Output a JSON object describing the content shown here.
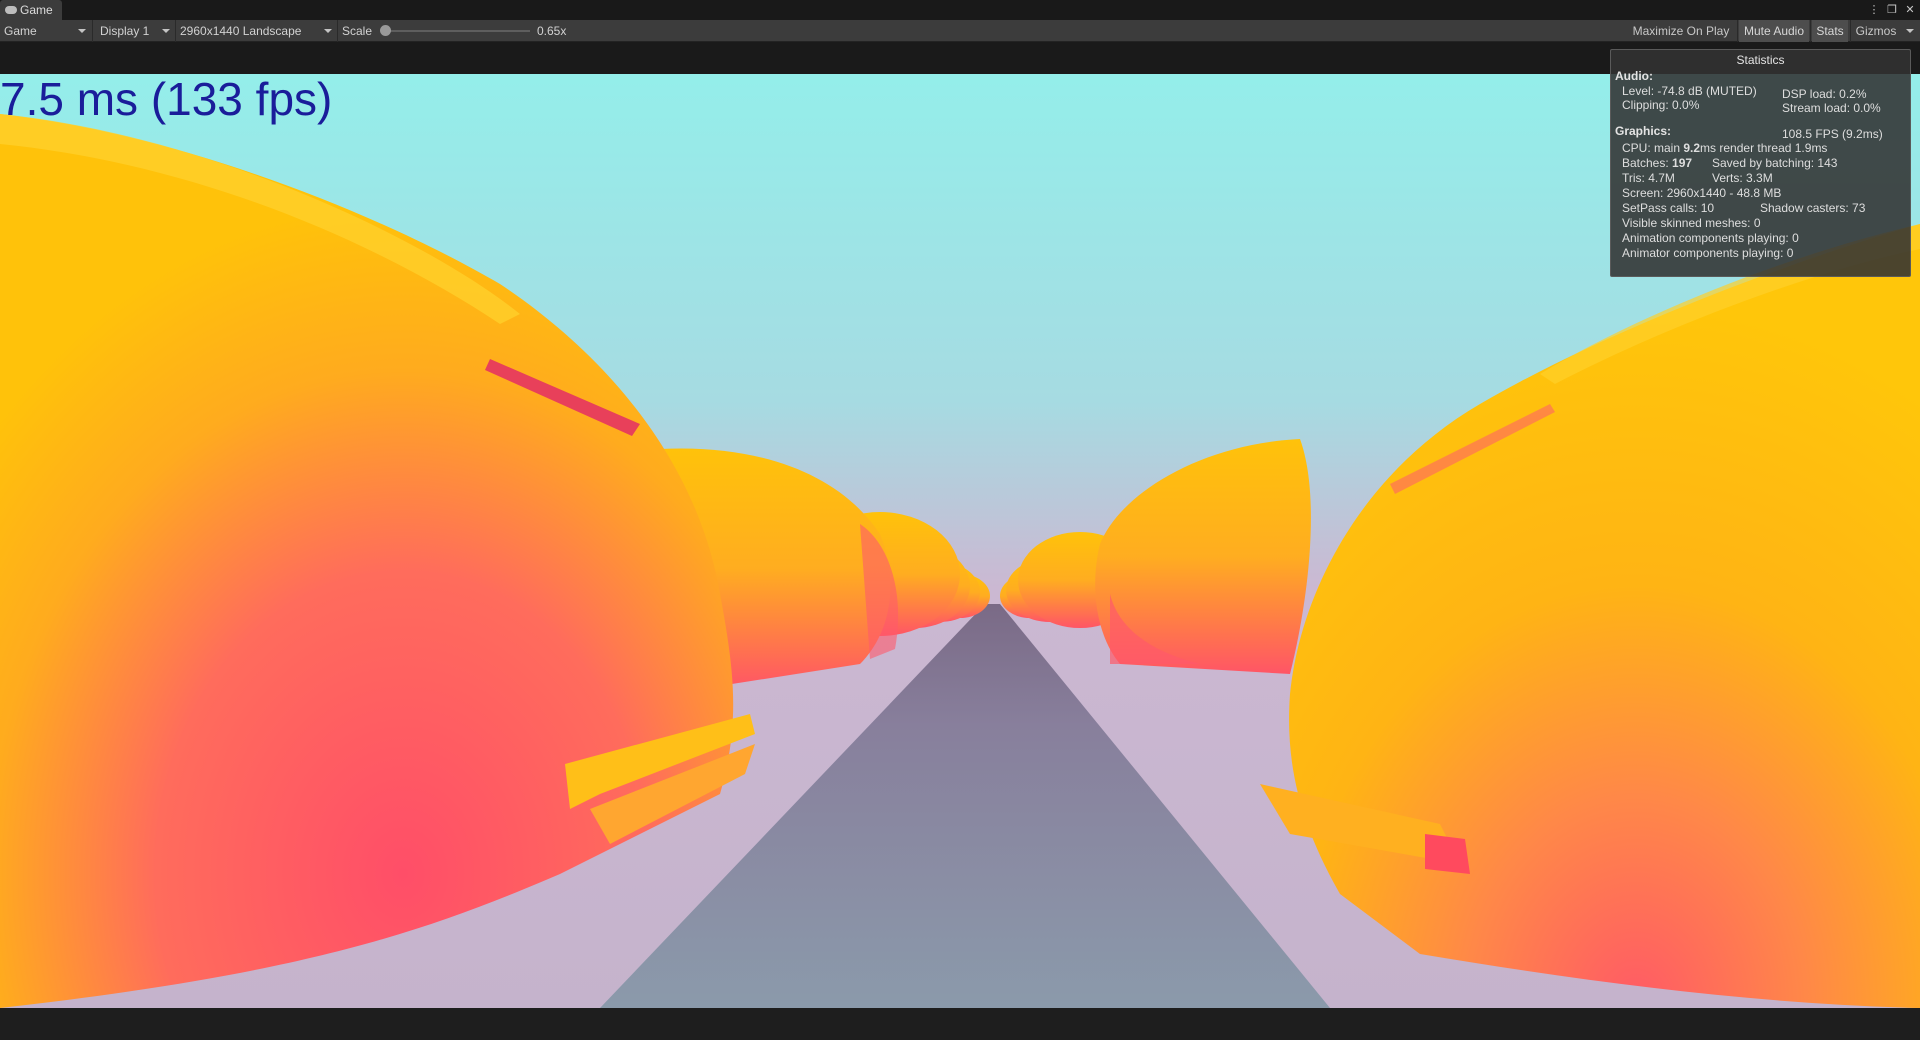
{
  "window": {
    "tab_label": "Game",
    "tab_icon": "gamepad-icon",
    "controls": [
      "more-icon",
      "maximize-icon",
      "close-icon"
    ]
  },
  "toolbar": {
    "view_mode": "Game",
    "display": "Display 1",
    "resolution": "2960x1440 Landscape",
    "scale_label": "Scale",
    "scale_value": "0.65x",
    "scale_fraction": 0.0,
    "maximize_on_play": "Maximize On Play",
    "mute_audio": "Mute Audio",
    "stats": "Stats",
    "gizmos": "Gizmos"
  },
  "overlay": {
    "fps_text": "7.5 ms (133 fps)"
  },
  "statistics": {
    "title": "Statistics",
    "audio_header": "Audio:",
    "level": "Level: -74.8 dB (MUTED)",
    "dsp_load": "DSP load: 0.2%",
    "clipping": "Clipping: 0.0%",
    "stream_load": "Stream load: 0.0%",
    "graphics_header": "Graphics:",
    "fps": "108.5 FPS (9.2ms)",
    "cpu_prefix": "CPU: main ",
    "cpu_main": "9.2",
    "cpu_suffix": "ms  render thread 1.9ms",
    "batches_prefix": "Batches: ",
    "batches_value": "197",
    "saved_by_batching": "Saved by batching: 143",
    "tris": "Tris: 4.7M",
    "verts": "Verts: 3.3M",
    "screen": "Screen: 2960x1440 - 48.8 MB",
    "setpass": "SetPass calls: 10",
    "shadow_casters": "Shadow casters: 73",
    "visible_skinned": "Visible skinned meshes: 0",
    "animation_components": "Animation components playing: 0",
    "animator_components": "Animator components playing: 0"
  },
  "colors": {
    "sky_top": "#94eeea",
    "sky_bottom": "#c8b9d0",
    "ground": "#8a90a6",
    "car_yellow": "#ffbd0a",
    "car_pink": "#ff5a6a",
    "fps_text": "#1a1d9a"
  }
}
